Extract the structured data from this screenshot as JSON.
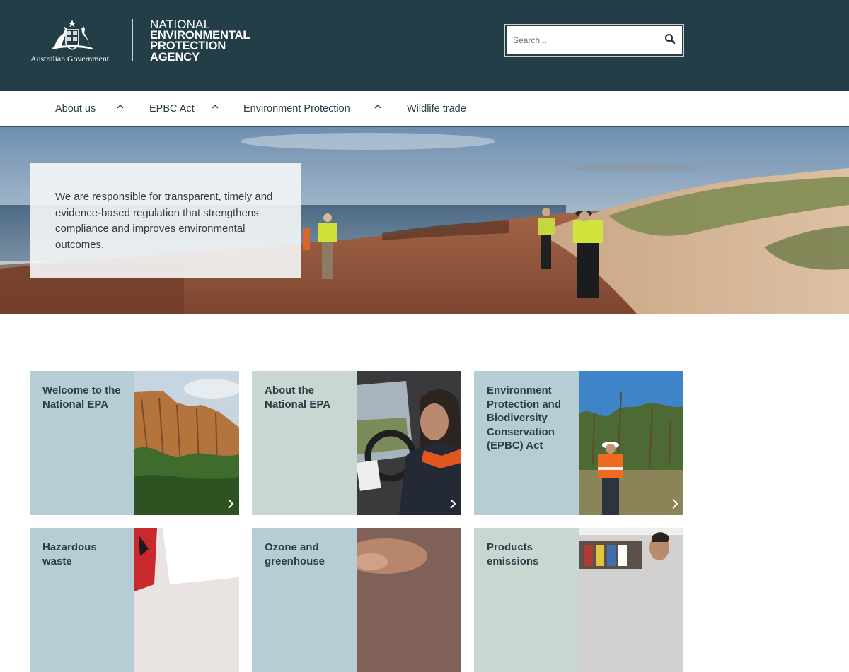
{
  "header": {
    "gov_name": "Australian Government",
    "agency_line1": "NATIONAL",
    "agency_line2": "ENVIRONMENTAL",
    "agency_line3": "PROTECTION",
    "agency_line4": "AGENCY",
    "search_placeholder": "Search...",
    "colors": {
      "background": "#243e47",
      "text": "#ffffff"
    }
  },
  "nav": {
    "items": [
      {
        "label": "About us",
        "has_submenu": true
      },
      {
        "label": "EPBC Act",
        "has_submenu": true
      },
      {
        "label": "Environment Protection",
        "has_submenu": true
      },
      {
        "label": "Wildlife trade",
        "has_submenu": false
      }
    ]
  },
  "hero": {
    "text": "We are responsible for transparent, timely and evidence-based regulation that strengthens compliance and improves environmental outcomes."
  },
  "tiles": [
    {
      "label": "Welcome to the National EPA",
      "image": "cliff-photo"
    },
    {
      "label": "About the National EPA",
      "image": "officer-in-vehicle-photo"
    },
    {
      "label": "Environment Protection and Biodiversity Conservation (EPBC) Act",
      "image": "field-worker-photo"
    },
    {
      "label": "Hazardous waste",
      "image": "hazard-flag-photo"
    },
    {
      "label": "Ozone and greenhouse",
      "image": "smoke-sky-photo"
    },
    {
      "label": "Products emissions",
      "image": "store-worker-photo"
    }
  ],
  "colors": {
    "tile_blue": "#b7cdd5",
    "tile_green": "#c9d6d2",
    "nav_border": "#3c4a50"
  }
}
